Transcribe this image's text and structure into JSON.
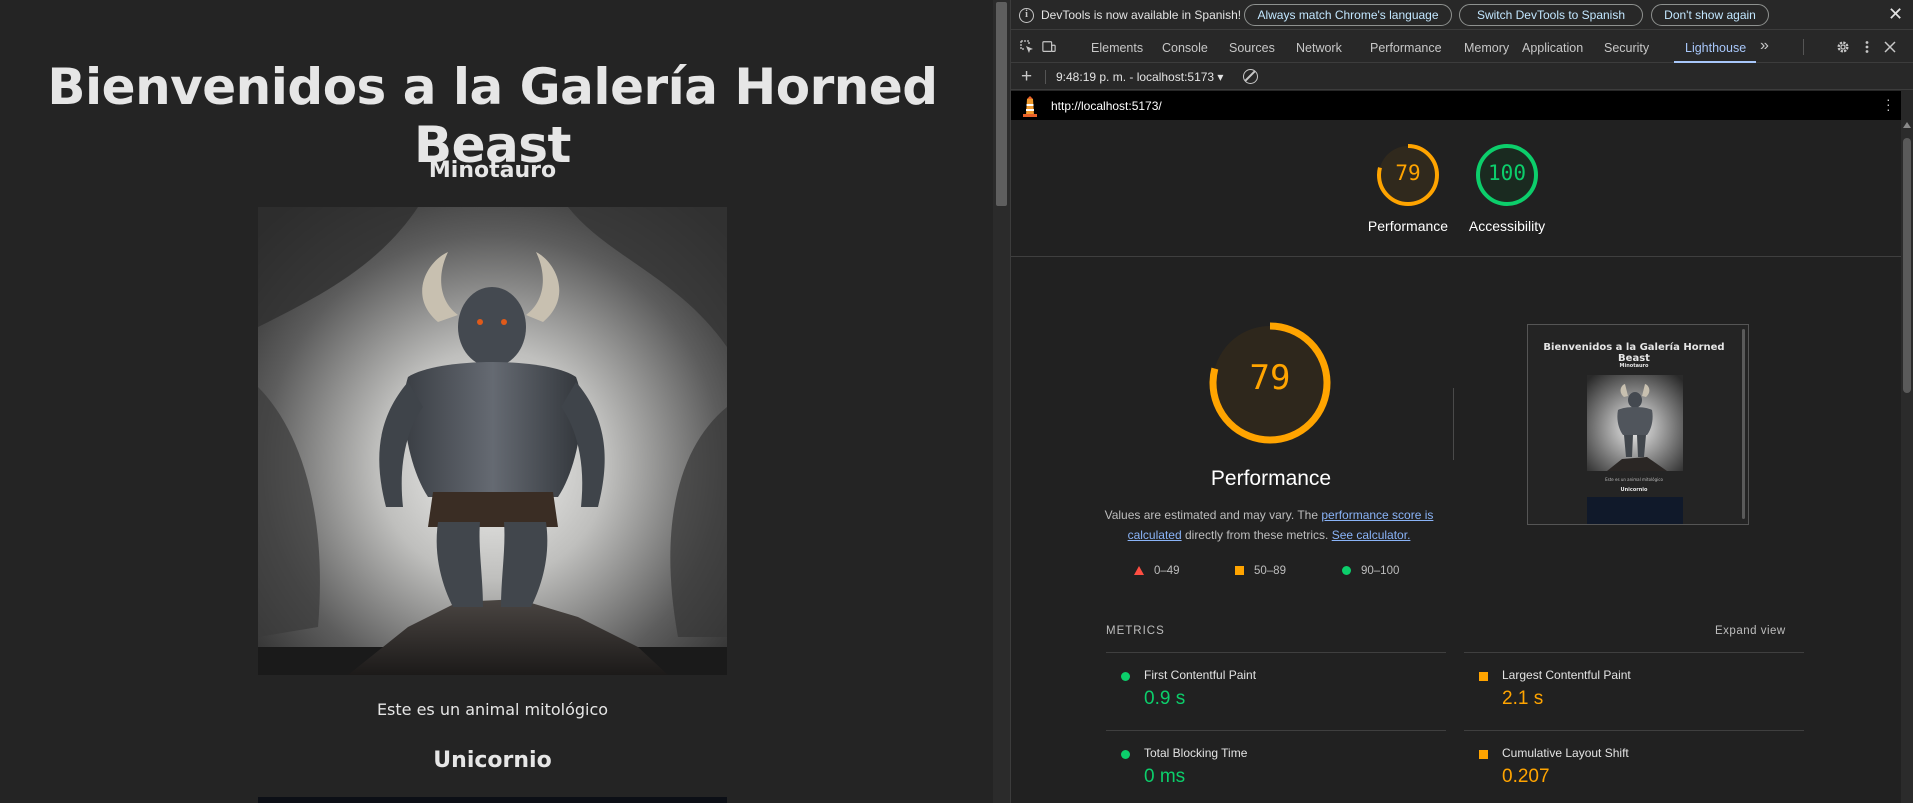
{
  "page": {
    "title": "Bienvenidos a la Galería Horned Beast",
    "beasts": [
      {
        "name": "Minotauro",
        "description": "Este es un animal mitológico"
      },
      {
        "name": "Unicornio",
        "description": ""
      }
    ]
  },
  "devtools": {
    "infobar": {
      "message": "DevTools is now available in Spanish!",
      "buttons": [
        "Always match Chrome's language",
        "Switch DevTools to Spanish",
        "Don't show again"
      ],
      "close": "✕"
    },
    "tabs": [
      "Elements",
      "Console",
      "Sources",
      "Network",
      "Performance",
      "Memory",
      "Application",
      "Security",
      "Lighthouse"
    ],
    "active_tab": "Lighthouse",
    "more_tabs": "»",
    "report_select": "9:48:19 p. m. - localhost:5173 ▾",
    "url": "http://localhost:5173/",
    "categories": [
      {
        "label": "Performance",
        "score": "79",
        "color": "#ffa400",
        "fraction": 0.79
      },
      {
        "label": "Accessibility",
        "score": "100",
        "color": "#0cce6b",
        "fraction": 1.0
      }
    ],
    "performance": {
      "score": "79",
      "fraction": 0.79,
      "title": "Performance",
      "note_prefix": "Values are estimated and may vary. The ",
      "note_link1": "performance score is calculated",
      "note_middle": " directly from these metrics. ",
      "note_link2": "See calculator.",
      "legend": [
        {
          "range": "0–49",
          "shape": "triangle",
          "color": "#ff4e42"
        },
        {
          "range": "50–89",
          "shape": "square",
          "color": "#ffa400"
        },
        {
          "range": "90–100",
          "shape": "circle",
          "color": "#0cce6b"
        }
      ]
    },
    "metrics_title": "METRICS",
    "expand_view": "Expand view",
    "metrics": [
      {
        "name": "First Contentful Paint",
        "value": "0.9 s",
        "status": "pass",
        "color": "#0cce6b"
      },
      {
        "name": "Largest Contentful Paint",
        "value": "2.1 s",
        "status": "average",
        "color": "#ffa400"
      },
      {
        "name": "Total Blocking Time",
        "value": "0 ms",
        "status": "pass",
        "color": "#0cce6b"
      },
      {
        "name": "Cumulative Layout Shift",
        "value": "0.207",
        "status": "average",
        "color": "#ffa400"
      }
    ],
    "thumbnail": {
      "title": "Bienvenidos a la Galería Horned Beast",
      "beast1": "Minotauro",
      "desc1": "Este es un animal mitológico",
      "beast2": "Unicornio"
    }
  }
}
